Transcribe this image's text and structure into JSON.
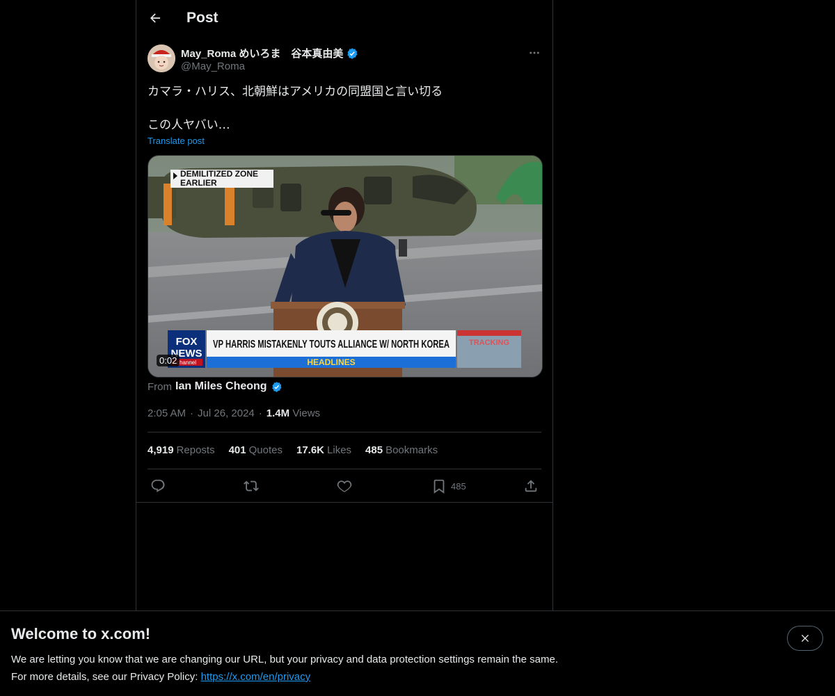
{
  "header": {
    "back_icon": "arrow-left-icon",
    "title": "Post"
  },
  "post": {
    "author": {
      "name": "May_Roma めいろま　谷本真由美",
      "handle": "@May_Roma",
      "verified": true
    },
    "text_lines": [
      "カマラ・ハリス、北朝鮮はアメリカの同盟国と言い切る",
      "この人ヤバい…"
    ],
    "translate_label": "Translate post",
    "media": {
      "overlay_top_1": "DEMILITIZED ZONE",
      "overlay_top_2": "EARLIER",
      "network_logo_1": "FOX",
      "network_logo_2": "NEWS",
      "network_logo_3": "channel",
      "headline": "VP HARRIS MISTAKENLY TOUTS ALLIANCE W/ NORTH KOREA",
      "headline_bar": "HEADLINES",
      "side_tag": "TRACKING",
      "duration": "0:02"
    },
    "from_label": "From",
    "from_name": "Ian Miles Cheong",
    "time": "2:05 AM",
    "date": "Jul 26, 2024",
    "views_count": "1.4M",
    "views_label": "Views",
    "stats": {
      "reposts_count": "4,919",
      "reposts_label": "Reposts",
      "quotes_count": "401",
      "quotes_label": "Quotes",
      "likes_count": "17.6K",
      "likes_label": "Likes",
      "bookmarks_count": "485",
      "bookmarks_label": "Bookmarks"
    },
    "actions": {
      "bookmark_count": "485"
    }
  },
  "banner": {
    "title": "Welcome to x.com!",
    "line1": "We are letting you know that we are changing our URL, but your privacy and data protection settings remain the same.",
    "line2_prefix": "For more details, see our Privacy Policy: ",
    "link": "https://x.com/en/privacy"
  },
  "colors": {
    "background": "#000000",
    "text": "#e7e9ea",
    "muted": "#71767b",
    "accent": "#1d9bf0",
    "border": "#2f3336"
  }
}
